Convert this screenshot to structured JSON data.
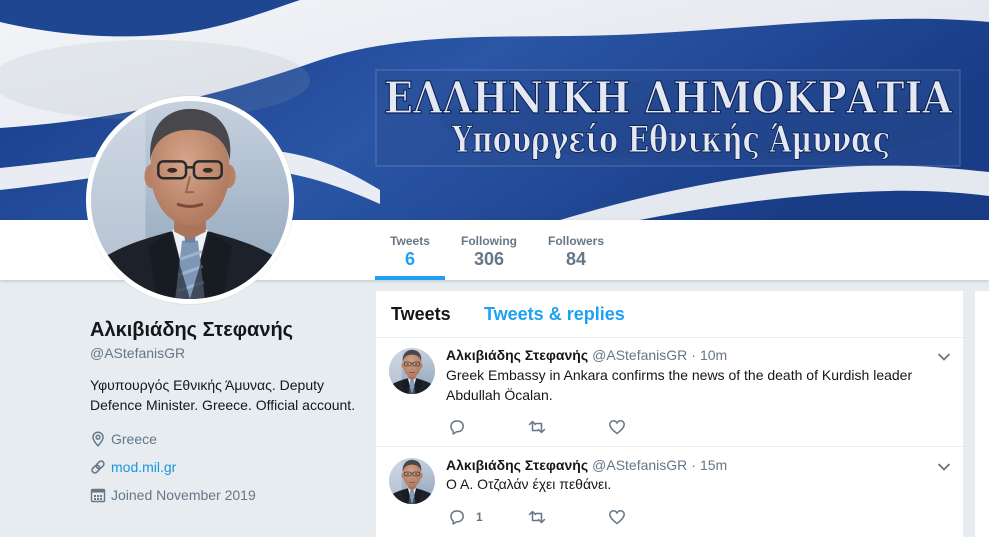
{
  "banner": {
    "line1": "ΕΛΛΗΝΙΚΗ ΔΗΜΟΚΡΑΤΙΑ",
    "line2": "Υπουργείο Εθνικής Άμυνας"
  },
  "nav": {
    "items": [
      {
        "label": "Tweets",
        "value": "6",
        "active": true
      },
      {
        "label": "Following",
        "value": "306",
        "active": false
      },
      {
        "label": "Followers",
        "value": "84",
        "active": false
      }
    ]
  },
  "profile": {
    "name": "Αλκιβιάδης Στεφανής",
    "handle": "@AStefanisGR",
    "bio": "Υφυπουργός Εθνικής Άμυνας. Deputy Defence Minister. Greece. Official account.",
    "location": "Greece",
    "location_icon": "map-pin-icon",
    "url": "mod.mil.gr",
    "url_icon": "link-icon",
    "joined": "Joined November 2019",
    "joined_icon": "calendar-icon"
  },
  "timeline": {
    "tabs": [
      {
        "label": "Tweets",
        "active": true
      },
      {
        "label": "Tweets & replies",
        "active": false
      }
    ],
    "tweets": [
      {
        "name": "Αλκιβιάδης Στεφανής",
        "handle": "@AStefanisGR",
        "separator": "·",
        "time": "10m",
        "text": "Greek Embassy in Ankara confirms the news of the death of Kurdish leader Abdullah Öcalan.",
        "actions": [
          "reply-icon",
          "retweet-icon",
          "heart-icon"
        ]
      },
      {
        "name": "Αλκιβιάδης Στεφανής",
        "handle": "@AStefanisGR",
        "separator": "·",
        "time": "15m",
        "text": "Ο Α. Οτζαλάν έχει πεθάνει.",
        "replies": "1",
        "actions": [
          "reply-icon",
          "retweet-icon",
          "heart-icon"
        ]
      }
    ]
  },
  "colors": {
    "accent": "#1da1f2",
    "link": "#1b95e0",
    "text": "#14171a",
    "muted": "#657786",
    "page_background": "#e6ecf0",
    "flag_blue": "#1d4590"
  }
}
